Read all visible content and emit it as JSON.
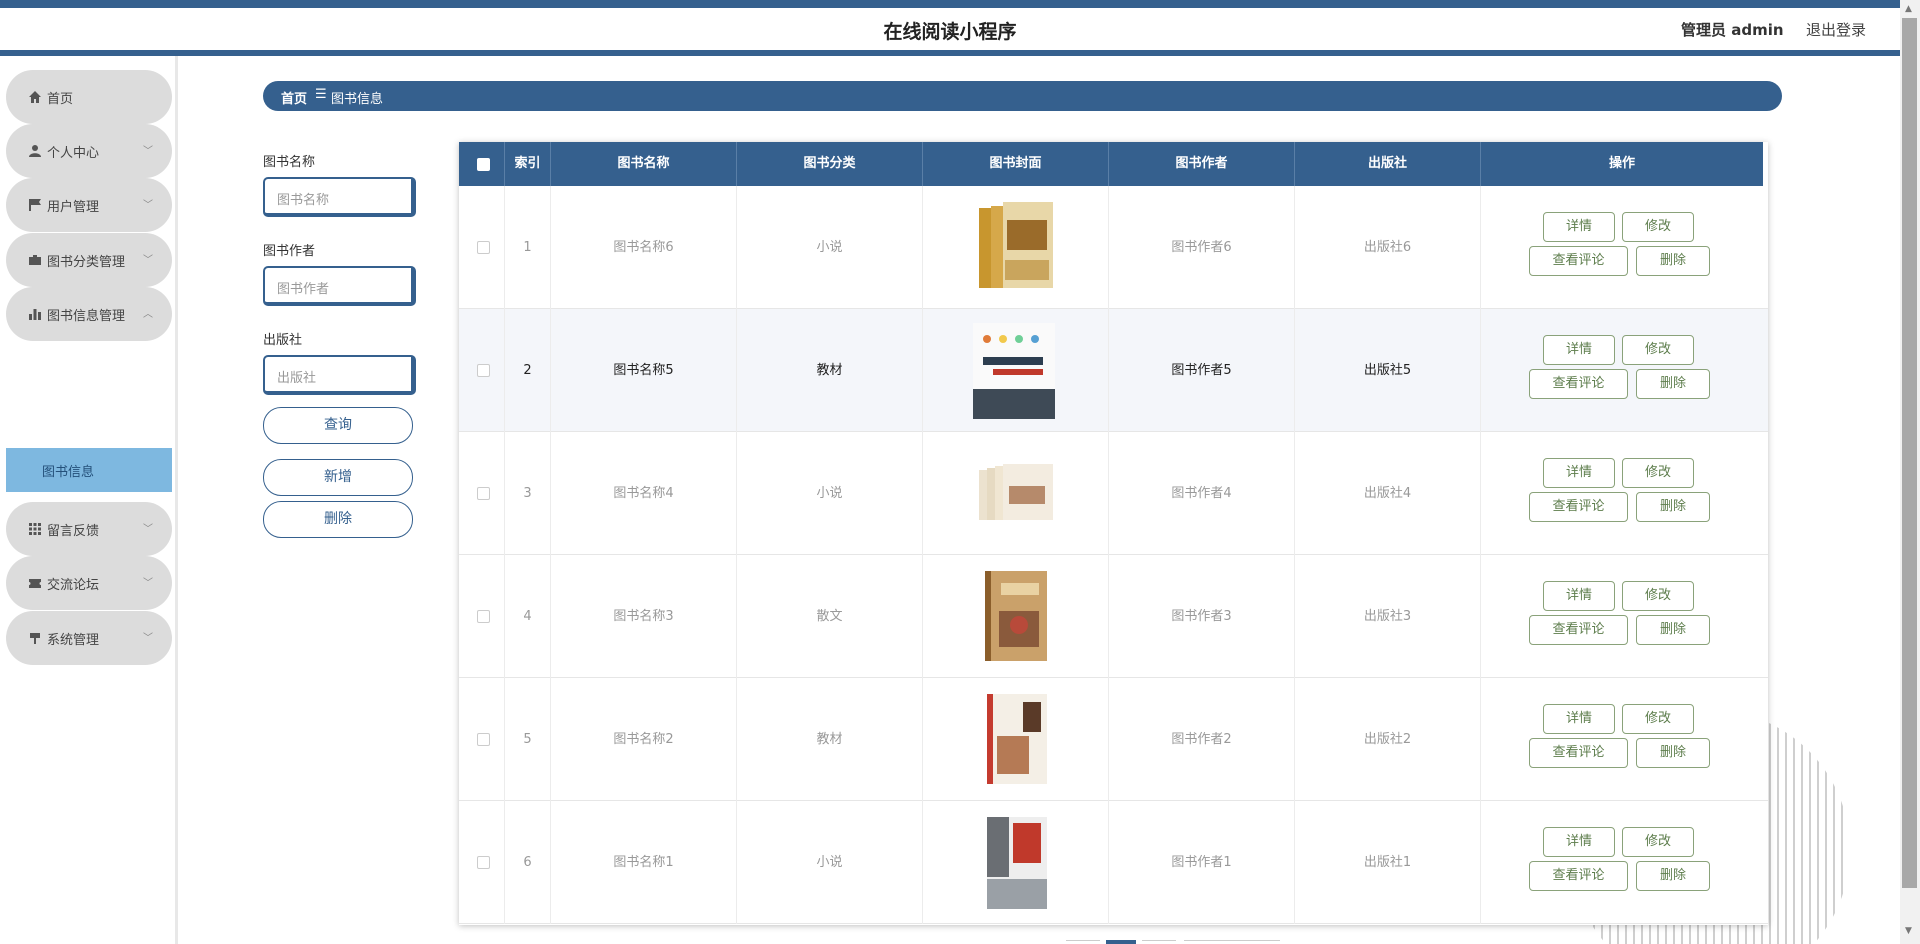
{
  "app": {
    "title": "在线阅读小程序",
    "admin_label": "管理员 admin",
    "logout_label": "退出登录"
  },
  "sidebar": {
    "items": [
      {
        "label": "首页",
        "icon": "home-icon",
        "expandable": false
      },
      {
        "label": "个人中心",
        "icon": "person-icon",
        "expandable": true
      },
      {
        "label": "用户管理",
        "icon": "flag-icon",
        "expandable": true
      },
      {
        "label": "图书分类管理",
        "icon": "briefcase-icon",
        "expandable": true
      },
      {
        "label": "图书信息管理",
        "icon": "bar-chart-icon",
        "expandable": true,
        "expanded": true
      },
      {
        "label": "留言反馈",
        "icon": "grid-icon",
        "expandable": true
      },
      {
        "label": "交流论坛",
        "icon": "ticket-icon",
        "expandable": true
      },
      {
        "label": "系统管理",
        "icon": "signpost-icon",
        "expandable": true
      }
    ],
    "active_sub": "图书信息"
  },
  "breadcrumb": {
    "home": "首页",
    "separator": "☰",
    "current": "图书信息"
  },
  "search": {
    "name_label": "图书名称",
    "name_placeholder": "图书名称",
    "author_label": "图书作者",
    "author_placeholder": "图书作者",
    "publisher_label": "出版社",
    "publisher_placeholder": "出版社",
    "query_label": "查询",
    "add_label": "新增",
    "delete_label": "删除"
  },
  "table": {
    "headers": [
      "索引",
      "图书名称",
      "图书分类",
      "图书封面",
      "图书作者",
      "出版社",
      "操作"
    ],
    "actions": {
      "detail": "详情",
      "edit": "修改",
      "comments": "查看评论",
      "delete": "删除"
    },
    "rows": [
      {
        "index": "1",
        "name": "图书名称6",
        "category": "小说",
        "author": "图书作者6",
        "publisher": "出版社6"
      },
      {
        "index": "2",
        "name": "图书名称5",
        "category": "教材",
        "author": "图书作者5",
        "publisher": "出版社5"
      },
      {
        "index": "3",
        "name": "图书名称4",
        "category": "小说",
        "author": "图书作者4",
        "publisher": "出版社4"
      },
      {
        "index": "4",
        "name": "图书名称3",
        "category": "散文",
        "author": "图书作者3",
        "publisher": "出版社3"
      },
      {
        "index": "5",
        "name": "图书名称2",
        "category": "教材",
        "author": "图书作者2",
        "publisher": "出版社2"
      },
      {
        "index": "6",
        "name": "图书名称1",
        "category": "小说",
        "author": "图书作者1",
        "publisher": "出版社1"
      }
    ]
  },
  "colors": {
    "primary": "#35608e",
    "sidebar_item": "#dcdcdc",
    "submenu_active": "#7eb8e0",
    "action_border": "#8aa27a"
  }
}
